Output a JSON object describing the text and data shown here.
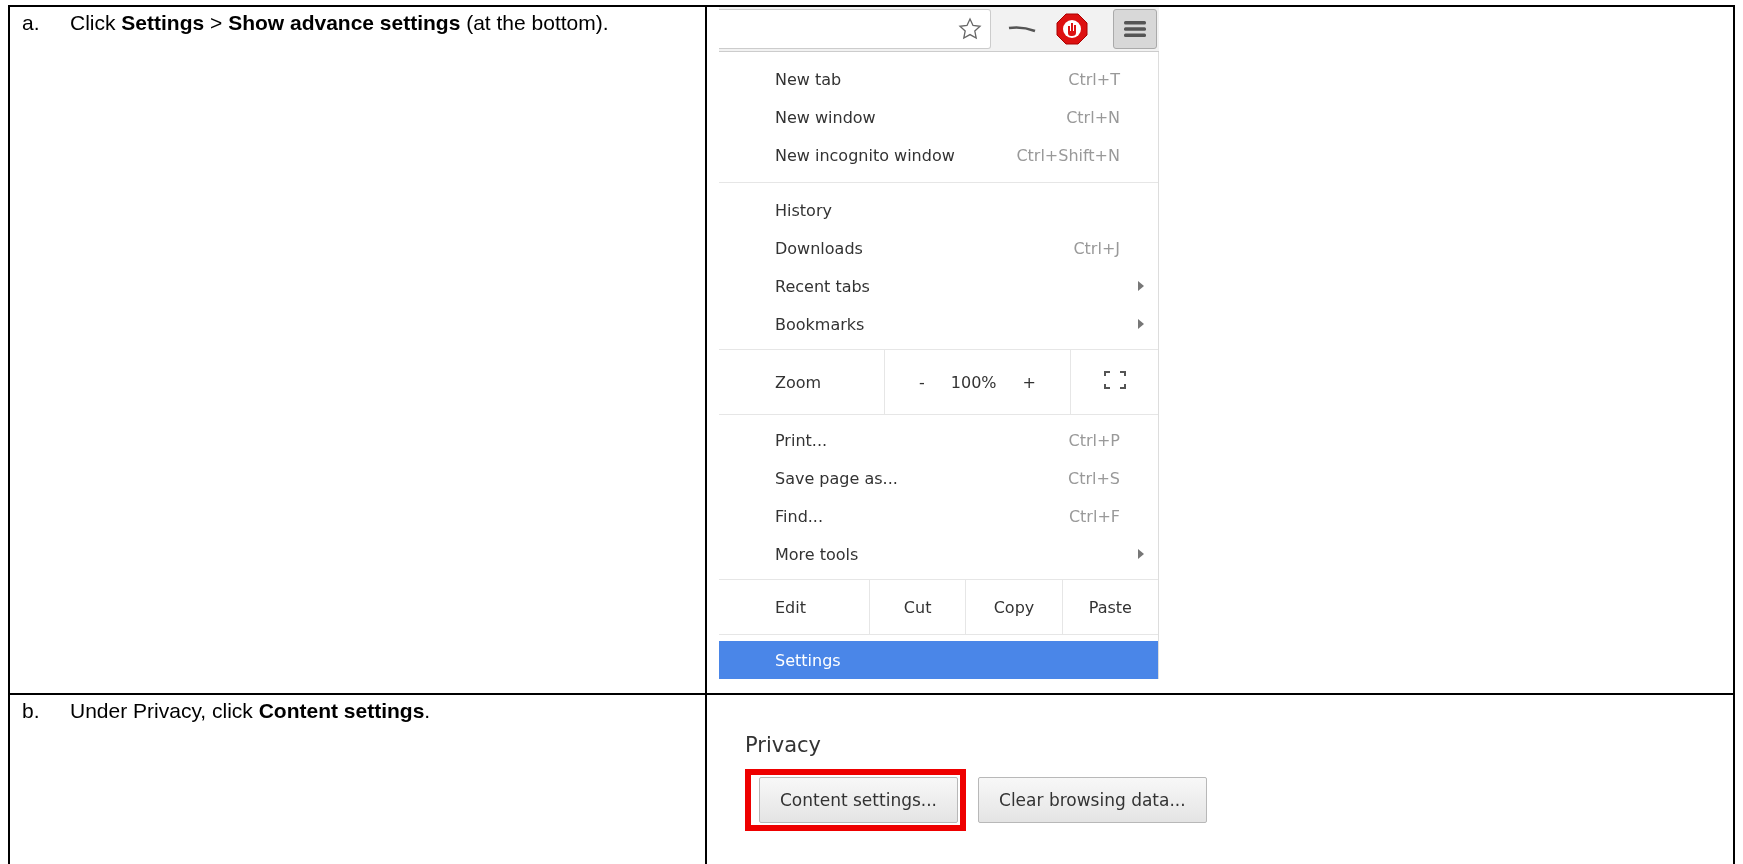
{
  "steps": [
    {
      "marker": "a.",
      "text": "Click **Settings** > **Show advance settings** (at the bottom).",
      "kind": "menu"
    },
    {
      "marker": "b.",
      "text": "Under Privacy, click **Content settings**.",
      "kind": "privacy"
    }
  ],
  "menu": {
    "items": [
      {
        "kind": "item",
        "label": "New tab",
        "shortcut": "Ctrl+T",
        "submenu": false,
        "selected": false
      },
      {
        "kind": "item",
        "label": "New window",
        "shortcut": "Ctrl+N",
        "submenu": false,
        "selected": false
      },
      {
        "kind": "item",
        "label": "New incognito window",
        "shortcut": "Ctrl+Shift+N",
        "submenu": false,
        "selected": false
      },
      {
        "kind": "separator"
      },
      {
        "kind": "item",
        "label": "History",
        "submenu": false,
        "selected": false
      },
      {
        "kind": "item",
        "label": "Downloads",
        "shortcut": "Ctrl+J",
        "submenu": false,
        "selected": false
      },
      {
        "kind": "item",
        "label": "Recent tabs",
        "submenu": true,
        "selected": false
      },
      {
        "kind": "item",
        "label": "Bookmarks",
        "submenu": true,
        "selected": false
      },
      {
        "kind": "zoom",
        "label": "Zoom",
        "minus": "-",
        "value": "100%",
        "plus": "+"
      },
      {
        "kind": "item",
        "label": "Print...",
        "shortcut": "Ctrl+P",
        "submenu": false,
        "selected": false
      },
      {
        "kind": "item",
        "label": "Save page as...",
        "shortcut": "Ctrl+S",
        "submenu": false,
        "selected": false
      },
      {
        "kind": "item",
        "label": "Find...",
        "shortcut": "Ctrl+F",
        "submenu": false,
        "selected": false
      },
      {
        "kind": "item",
        "label": "More tools",
        "submenu": true,
        "selected": false
      },
      {
        "kind": "edit",
        "label": "Edit",
        "actions": [
          "Cut",
          "Copy",
          "Paste"
        ]
      },
      {
        "kind": "item",
        "label": "Settings",
        "submenu": false,
        "selected": true
      }
    ]
  },
  "privacy": {
    "heading": "Privacy",
    "buttons": [
      {
        "label": "Content settings...",
        "highlighted": true
      },
      {
        "label": "Clear browsing data...",
        "highlighted": false
      }
    ]
  }
}
